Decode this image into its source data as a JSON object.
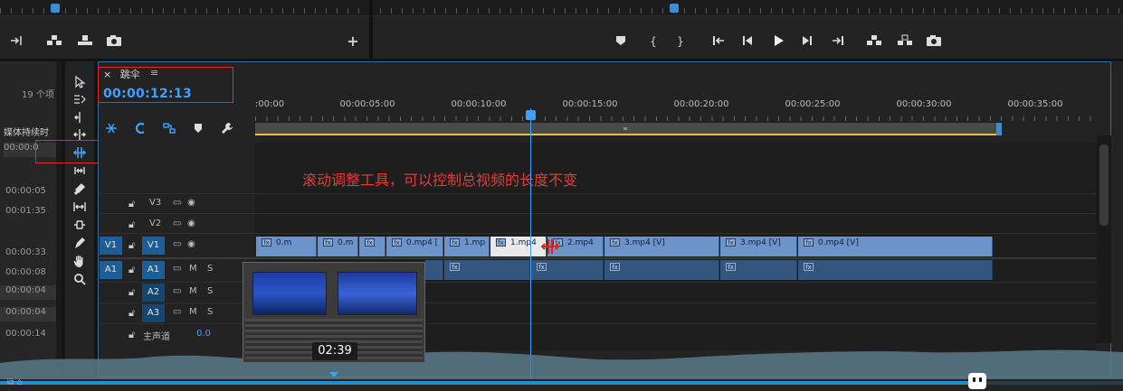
{
  "source_monitor": {
    "controls": [
      "mark-out-icon",
      "insert-icon",
      "overwrite-icon",
      "export-frame-icon",
      "add-button-icon"
    ],
    "add_label": "+"
  },
  "program_monitor": {
    "controls": [
      "add-marker-icon",
      "mark-in-icon",
      "mark-out-icon",
      "go-to-in-icon",
      "step-back-icon",
      "play-icon",
      "step-forward-icon",
      "go-to-out-icon",
      "lift-icon",
      "extract-icon",
      "export-frame-icon"
    ],
    "marker_glyph": "▾",
    "in_glyph": "{",
    "out_glyph": "}"
  },
  "project_panel": {
    "item_count": "19 个项",
    "column_header": "媒体持续时",
    "rows": [
      "00:00:0",
      "00:00:05",
      "00:01:35",
      "00:00:33",
      "00:00:08",
      "00:00:04",
      "00:00:04",
      "00:00:14"
    ]
  },
  "timeline": {
    "sequence_name": "跳伞",
    "close_glyph": "×",
    "menu_glyph": "≡",
    "timecode": "00:00:12:13",
    "ruler_labels": [
      ":00:00",
      "00:00:05:00",
      "00:00:10:00",
      "00:00:15:00",
      "00:00:20:00",
      "00:00:25:00",
      "00:00:30:00",
      "00:00:35:00"
    ],
    "annotation": "滚动调整工具，可以控制总视频的长度不变",
    "tracks": {
      "v3": {
        "label": "V3"
      },
      "v2": {
        "label": "V2"
      },
      "v1": {
        "source": "V1",
        "label": "V1"
      },
      "a1": {
        "source": "A1",
        "label": "A1",
        "m": "M",
        "s": "S"
      },
      "a2": {
        "label": "A2",
        "m": "M",
        "s": "S"
      },
      "a3": {
        "label": "A3",
        "m": "M",
        "s": "S"
      },
      "master": {
        "label": "主声道",
        "value": "0.0"
      }
    },
    "video_clips": [
      "0.m",
      "0.m",
      "",
      "0.mp4 [",
      "1.mp",
      "1.mp4",
      "2.mp4",
      "3.mp4 [V]",
      "3.mp4 [V]",
      "0.mp4 [V]"
    ],
    "fx_label": "fx"
  },
  "hover_preview": {
    "time": "02:39"
  },
  "player": {
    "progress_percent": 87
  },
  "colors": {
    "accent": "#3ea1ff",
    "video_clip": "#6d94c9",
    "audio_clip": "#33557e",
    "annotation": "#e23b3b",
    "work_area_line": "#e5c33a"
  }
}
